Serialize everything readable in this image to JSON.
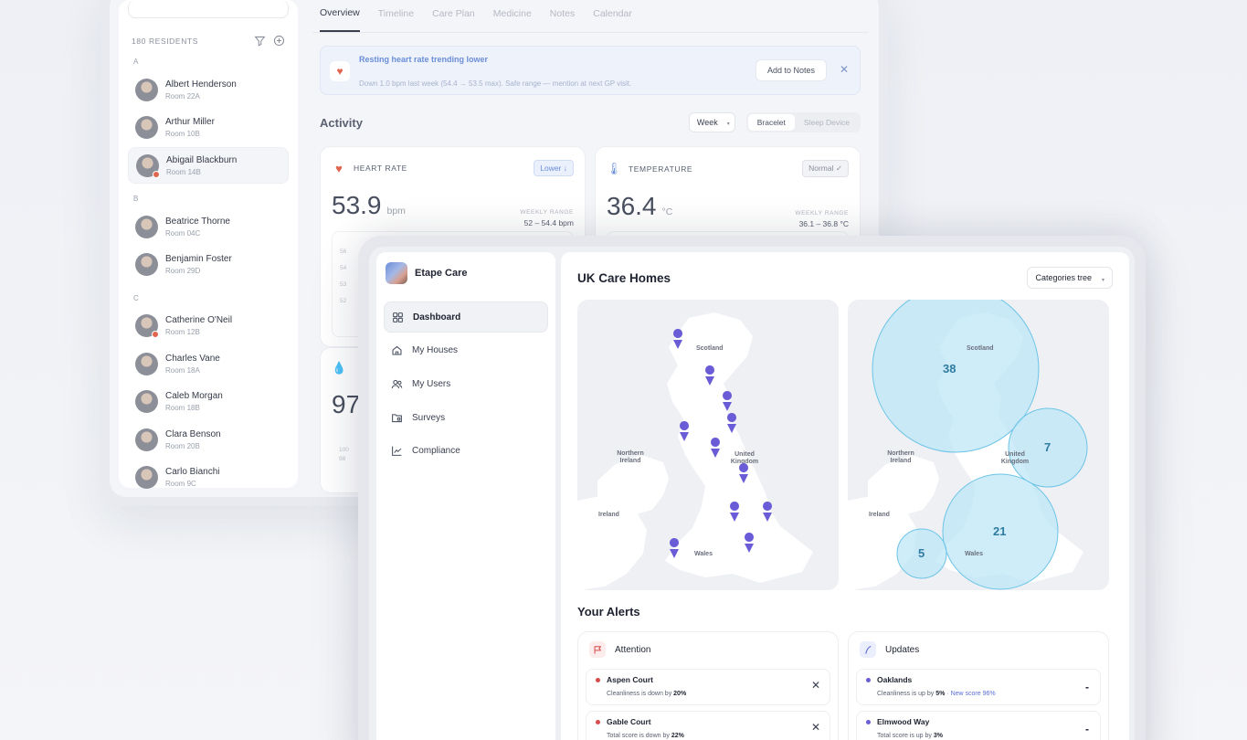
{
  "residents": {
    "count_label": "180 RESIDENTS",
    "groups": [
      {
        "letter": "A",
        "items": [
          {
            "name": "Albert Henderson",
            "room": "Room 22A"
          },
          {
            "name": "Arthur Miller",
            "room": "Room 10B"
          },
          {
            "name": "Abigail Blackburn",
            "room": "Room 14B"
          }
        ]
      },
      {
        "letter": "B",
        "items": [
          {
            "name": "Beatrice Thorne",
            "room": "Room 04C"
          },
          {
            "name": "Benjamin Foster",
            "room": "Room 29D"
          }
        ]
      },
      {
        "letter": "C",
        "items": [
          {
            "name": "Catherine O'Neil",
            "room": "Room 12B"
          },
          {
            "name": "Charles Vane",
            "room": "Room 18A"
          },
          {
            "name": "Caleb Morgan",
            "room": "Room 18B"
          },
          {
            "name": "Clara Benson",
            "room": "Room 20B"
          },
          {
            "name": "Carlo Bianchi",
            "room": "Room 9C"
          }
        ]
      }
    ]
  },
  "resident_tabs": [
    "Overview",
    "Timeline",
    "Care Plan",
    "Medicine",
    "Notes",
    "Calendar"
  ],
  "notice": {
    "title": "Resting heart rate trending lower",
    "body": "Down 1.0 bpm last week (54.4 → 53.5 max). Safe range — mention at next GP visit.",
    "button": "Add to Notes",
    "close": "✕"
  },
  "activity": {
    "title": "Activity",
    "period": "Week",
    "segments": [
      "Bracelet",
      "Sleep Device"
    ]
  },
  "metrics": [
    {
      "title": "HEART RATE",
      "badge": "Lower ↓",
      "value": "53.9",
      "unit": "bpm",
      "range_label": "WEEKLY RANGE",
      "range": "52 – 54.4 bpm",
      "ticks": [
        "56",
        "54",
        "53",
        "52"
      ]
    },
    {
      "title": "TEMPERATURE",
      "badge": "Normal ✓",
      "value": "36.4",
      "unit": "°C",
      "range_label": "WEEKLY RANGE",
      "range": "36.1 – 36.8 °C"
    }
  ],
  "third_metric": {
    "value": "97",
    "ticks": [
      "100",
      "98"
    ]
  },
  "app": {
    "brand": "Etape Care",
    "nav": [
      "Dashboard",
      "My Houses",
      "My Users",
      "Surveys",
      "Compliance"
    ]
  },
  "dashboard": {
    "title": "UK Care Homes",
    "filter": "Categories tree",
    "regions": {
      "scotland": "Scotland",
      "ni": "Northern Ireland",
      "uk": "United Kingdom",
      "ireland": "Ireland",
      "wales": "Wales"
    },
    "clusters": [
      {
        "label": "38"
      },
      {
        "label": "7"
      },
      {
        "label": "21"
      },
      {
        "label": "5"
      }
    ],
    "alerts_title": "Your Alerts",
    "attention": {
      "title": "Attention",
      "items": [
        {
          "name": "Aspen Court",
          "text": "Cleanliness is down by",
          "value": "20%"
        },
        {
          "name": "Gable Court",
          "text": "Total score is down by",
          "value": "22%"
        }
      ]
    },
    "updates": {
      "title": "Updates",
      "items": [
        {
          "name": "Oaklands",
          "text": "Cleanliness is up by",
          "value": "5%",
          "extra": "· New score 96%"
        },
        {
          "name": "Elmwood Way",
          "text": "Total score is up by",
          "value": "3%"
        }
      ]
    }
  },
  "colors": {
    "accent": "#6a5cd6",
    "cluster": "#bde6f6",
    "danger": "#d94b4b"
  }
}
